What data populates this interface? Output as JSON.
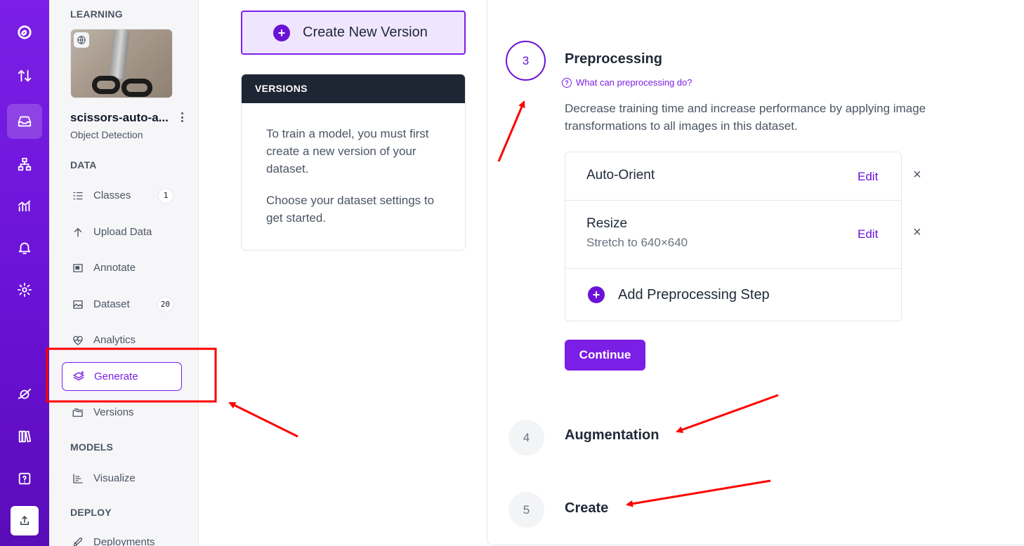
{
  "rail": {
    "icons": [
      "logo-icon",
      "arrows-updown-icon",
      "inbox-icon",
      "workflow-icon",
      "chart-icon",
      "bell-icon",
      "gear-icon",
      "universe-icon",
      "books-icon",
      "help-icon",
      "upload-icon"
    ],
    "active": "inbox-icon"
  },
  "sidebar": {
    "workspace_label": "LEARNING",
    "project": {
      "name": "scissors-auto-a...",
      "type": "Object Detection"
    },
    "sections": {
      "data": "DATA",
      "models": "MODELS",
      "deploy": "DEPLOY"
    },
    "items": [
      {
        "label": "Classes",
        "icon": "list-icon",
        "count": "1"
      },
      {
        "label": "Upload Data",
        "icon": "arrow-up-icon"
      },
      {
        "label": "Annotate",
        "icon": "annotate-icon"
      },
      {
        "label": "Dataset",
        "icon": "image-icon",
        "count": "20"
      },
      {
        "label": "Analytics",
        "icon": "heart-pulse-icon"
      },
      {
        "label": "Generate",
        "icon": "layers-sparkle-icon",
        "selected": true
      },
      {
        "label": "Versions",
        "icon": "folders-icon"
      },
      {
        "label": "Visualize",
        "icon": "bar-chart-icon"
      },
      {
        "label": "Deployments",
        "icon": "rocket-icon"
      }
    ]
  },
  "main": {
    "create_button": "Create New Version",
    "versions": {
      "header": "VERSIONS",
      "p1": "To train a model, you must first create a new version of your dataset.",
      "p2": "Choose your dataset settings to get started."
    }
  },
  "wizard": {
    "step3": {
      "number": "3",
      "title": "Preprocessing",
      "help": "What can preprocessing do?",
      "description": "Decrease training time and increase performance by applying image transformations to all images in this dataset.",
      "steps": [
        {
          "name": "Auto-Orient",
          "edit": "Edit",
          "remove": "×"
        },
        {
          "name": "Resize",
          "detail": "Stretch to 640×640",
          "edit": "Edit",
          "remove": "×"
        }
      ],
      "add_label": "Add Preprocessing Step",
      "continue_label": "Continue"
    },
    "step4": {
      "number": "4",
      "title": "Augmentation"
    },
    "step5": {
      "number": "5",
      "title": "Create"
    }
  },
  "colors": {
    "brand": "#7c1fe6",
    "brand_dark": "#6a12d6",
    "annotation": "#ff0000",
    "versions_header": "#1e2533"
  }
}
